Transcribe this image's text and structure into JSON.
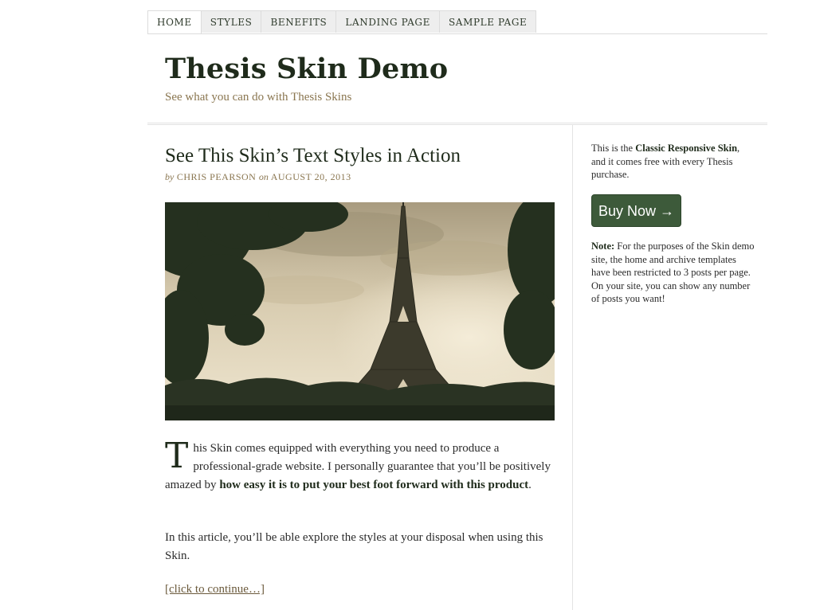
{
  "nav": {
    "tabs": [
      {
        "label": "HOME",
        "active": true
      },
      {
        "label": "STYLES"
      },
      {
        "label": "BENEFITS"
      },
      {
        "label": "LANDING PAGE"
      },
      {
        "label": "SAMPLE PAGE"
      }
    ]
  },
  "header": {
    "title": "Thesis Skin Demo",
    "tagline": "See what you can do with Thesis Skins"
  },
  "post": {
    "title": "See This Skin’s Text Styles in Action",
    "byline_by": "by",
    "author": "CHRIS PEARSON",
    "byline_on": "on",
    "date": "AUGUST 20, 2013",
    "dropcap": "T",
    "p1_text": "his Skin comes equipped with everything you need to produce a professional-grade website. I personally guarantee that you’ll be positively amazed by ",
    "p1_bold": "how easy it is to put your best foot forward with this product",
    "p1_end": ".",
    "p2": "In this article, you’ll be able explore the styles at your disposal when using this Skin.",
    "continue": "[click to continue…]"
  },
  "sidebar": {
    "intro_pre": "This is the ",
    "intro_bold": "Classic Responsive Skin",
    "intro_post": ", and it comes free with every Thesis purchase.",
    "buy_label": "Buy Now →",
    "note_label": "Note:",
    "note_text": " For the purposes of the Skin demo site, the home and archive templates have been restricted to 3 posts per page. On your site, you can show any number of posts you want!"
  },
  "colors": {
    "accent_green": "#3d5a3a",
    "title_dark": "#1f2b1b",
    "meta_tan": "#8a7650"
  }
}
